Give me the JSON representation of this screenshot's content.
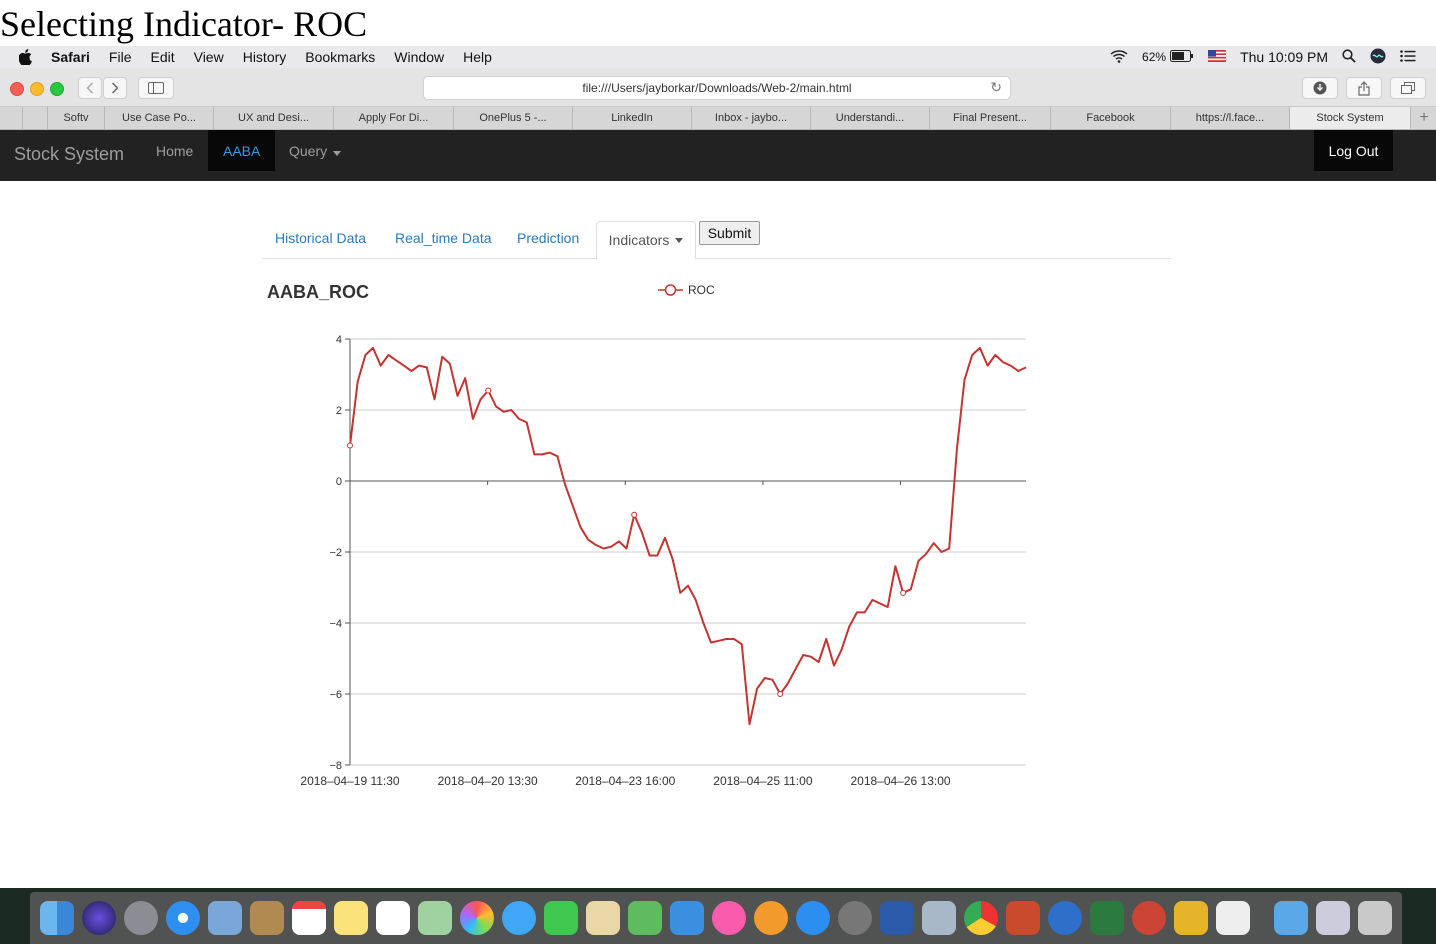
{
  "caption": "Selecting Indicator- ROC",
  "menubar": {
    "app": "Safari",
    "items": [
      "File",
      "Edit",
      "View",
      "History",
      "Bookmarks",
      "Window",
      "Help"
    ],
    "battery": "62%",
    "clock": "Thu 10:09 PM"
  },
  "toolbar": {
    "url": "file:///Users/jayborkar/Downloads/Web-2/main.html"
  },
  "browser_tabs": [
    "Softv",
    "Use Case Po...",
    "UX and Desi...",
    "Apply For Di...",
    "OnePlus 5 -...",
    "LinkedIn",
    "Inbox - jaybo...",
    "Understandi...",
    "Final Present...",
    "Facebook",
    "https://l.face...",
    "Stock System"
  ],
  "navbar": {
    "brand": "Stock System",
    "home": "Home",
    "aaba": "AABA",
    "query": "Query",
    "logout": "Log Out"
  },
  "page_tabs": {
    "historical": "Historical Data",
    "realtime": "Real_time Data",
    "prediction": "Prediction",
    "indicators": "Indicators",
    "submit": "Submit"
  },
  "chart_title": "AABA_ROC",
  "chart_data": {
    "type": "line",
    "title": "AABA_ROC",
    "legend": "ROC",
    "legend_position": "top-center",
    "color": "#c23531",
    "grid": true,
    "ylim": [
      -8,
      4
    ],
    "yticks": [
      4,
      2,
      0,
      -2,
      -4,
      -6,
      -8
    ],
    "xtick_labels": [
      "2018-04-19 11:30",
      "2018-04-20 13:30",
      "2018-04-23 16:00",
      "2018-04-25 11:00",
      "2018-04-26 13:00"
    ],
    "series": [
      {
        "name": "ROC",
        "values": [
          1.0,
          2.8,
          3.55,
          3.75,
          3.25,
          3.55,
          3.4,
          3.25,
          3.1,
          3.25,
          3.2,
          2.3,
          3.5,
          3.3,
          2.4,
          2.9,
          1.75,
          2.3,
          2.55,
          2.1,
          1.95,
          2.0,
          1.75,
          1.65,
          0.75,
          0.75,
          0.8,
          0.7,
          -0.1,
          -0.7,
          -1.3,
          -1.65,
          -1.8,
          -1.9,
          -1.85,
          -1.7,
          -1.9,
          -0.95,
          -1.45,
          -2.1,
          -2.1,
          -1.6,
          -2.2,
          -3.15,
          -2.95,
          -3.35,
          -4.0,
          -4.55,
          -4.5,
          -4.45,
          -4.45,
          -4.6,
          -6.85,
          -5.85,
          -5.55,
          -5.6,
          -6.0,
          -5.7,
          -5.3,
          -4.9,
          -4.95,
          -5.1,
          -4.45,
          -5.2,
          -4.75,
          -4.1,
          -3.7,
          -3.7,
          -3.35,
          -3.45,
          -3.55,
          -2.4,
          -3.15,
          -3.05,
          -2.25,
          -2.05,
          -1.75,
          -2.0,
          -1.9,
          0.9,
          2.85,
          3.55,
          3.75,
          3.25,
          3.55,
          3.35,
          3.25,
          3.1,
          3.2
        ],
        "marked_points": [
          0,
          18,
          37,
          56,
          72
        ]
      }
    ]
  }
}
